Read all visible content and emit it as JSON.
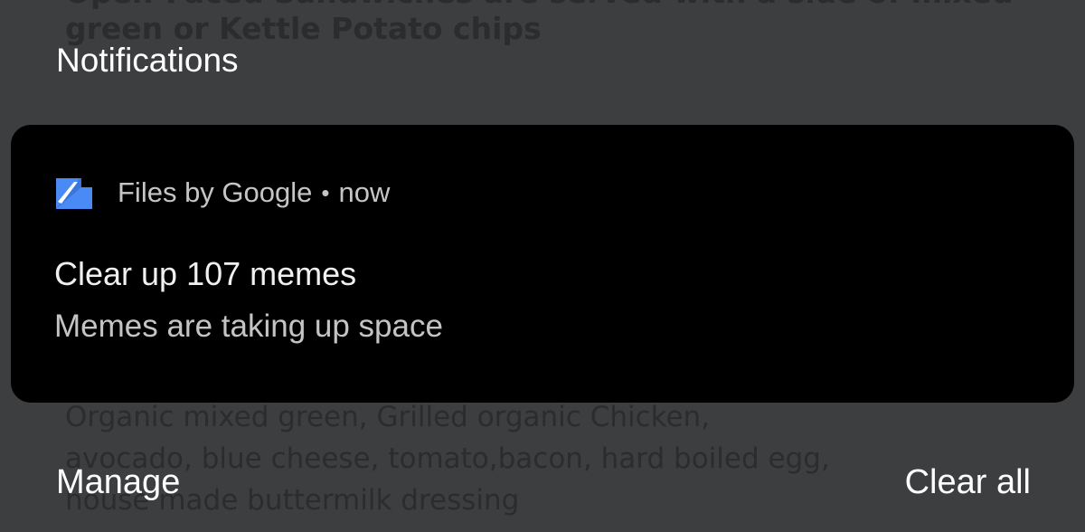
{
  "background": {
    "top_lines": [
      "Open-Faced Sandwiches are served with a side of mixed",
      "green or Kettle Potato chips"
    ],
    "bottom_lines": [
      "Organic mixed green, Grilled organic Chicken,",
      "avocado, blue cheese, tomato,bacon, hard boiled egg,",
      "house made buttermilk dressing"
    ]
  },
  "shade": {
    "title": "Notifications",
    "manage_label": "Manage",
    "clear_all_label": "Clear all"
  },
  "notification": {
    "icon": "files-by-google-icon",
    "icon_color": "#4a8af4",
    "app_name": "Files by Google",
    "separator": "•",
    "time": "now",
    "title": "Clear up 107 memes",
    "body": "Memes are taking up space"
  }
}
